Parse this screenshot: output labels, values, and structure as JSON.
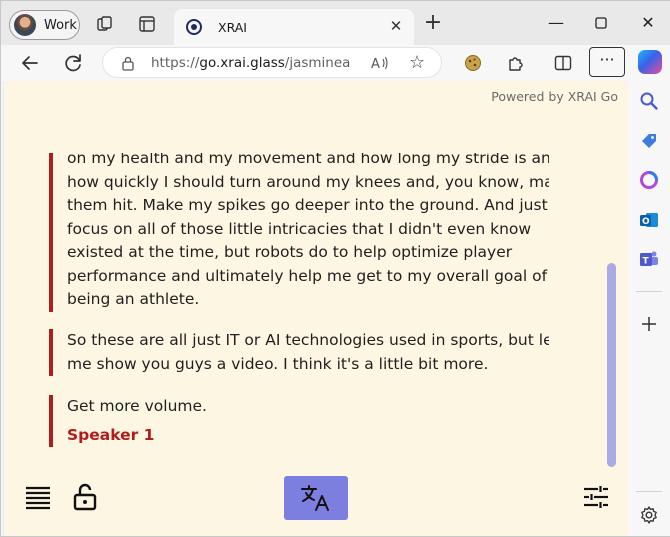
{
  "browser": {
    "profile_label": "Work",
    "tab_title": "XRAI",
    "url_prefix": "https://",
    "url_host": "go.xrai.glass",
    "url_path": "/jasminea"
  },
  "page": {
    "powered_by": "Powered by XRAI Go",
    "transcript": [
      {
        "lines": [
          "on my health and my movement and how long my stride is and",
          "how quickly I should turn around my knees and, you know, make",
          "them hit. Make my spikes go deeper into the ground. And just",
          "focus on all of those little intricacies that I didn't even know",
          "existed at the time, but robots do to help optimize player",
          "performance and ultimately help me get to my overall goal of",
          "being an athlete."
        ]
      },
      {
        "lines": [
          "So these are all just IT or AI technologies used in sports, but let",
          "me show you guys a video. I think it's a little bit more."
        ]
      },
      {
        "lines": [
          "Get more volume."
        ],
        "speaker": "Speaker 1"
      }
    ]
  },
  "colors": {
    "accent_red": "#b01d1d",
    "translate_button": "#7d7fe0",
    "page_background": "#fdf6e3"
  }
}
